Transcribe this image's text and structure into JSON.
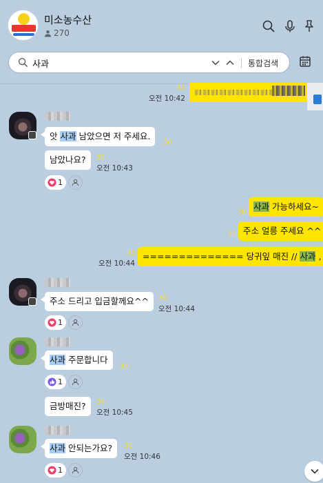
{
  "header": {
    "title": "미소농수산",
    "member_count": "270",
    "logo_text": "미소농수산"
  },
  "search": {
    "query": "사과",
    "all_label": "통합검색"
  },
  "messages": {
    "m0": {
      "read": "30",
      "time": "오전 10:42"
    },
    "m1": {
      "pre": "앗 ",
      "kw": "사과",
      "post": " 남았으면 저 주세요.",
      "read": "30"
    },
    "m2": {
      "text": "남았나요?",
      "read": "30",
      "time": "오전 10:43",
      "react_count": "1"
    },
    "m3": {
      "kw": "사과",
      "post": " 가능하세요~",
      "read": "30"
    },
    "m4": {
      "text": "주소 얼릉 주세요 ^^",
      "read": "30"
    },
    "m5": {
      "pre": "============== 당귀잎 매진 // ",
      "kw": "사과",
      "post": " , 매진",
      "read": "30",
      "time": "오전 10:44"
    },
    "m6": {
      "text": "주소 드리고 입금할께요^^",
      "read": "30",
      "time": "오전 10:44",
      "react_count": "1"
    },
    "m7": {
      "kw": "사과",
      "post": " 주문합니다",
      "read": "30",
      "react_count": "1"
    },
    "m8": {
      "text": "금방매진?",
      "read": "30",
      "time": "오전 10:45"
    },
    "m9": {
      "kw": "사과",
      "post": " 안되는가요?",
      "read": "30",
      "time": "오전 10:46",
      "react_count": "1"
    }
  },
  "colors": {
    "background": "#bacee0",
    "my_bubble": "#fee500",
    "other_bubble": "#ffffff",
    "highlight_blue": "#a8cdf5",
    "highlight_green": "#8ab44e",
    "read_count": "#f0de3a"
  },
  "icons": [
    "search-icon",
    "microphone-icon",
    "pin-icon",
    "chevron-down-icon",
    "chevron-up-icon",
    "calendar-icon",
    "heart-icon",
    "thumbs-up-icon",
    "person-icon"
  ]
}
